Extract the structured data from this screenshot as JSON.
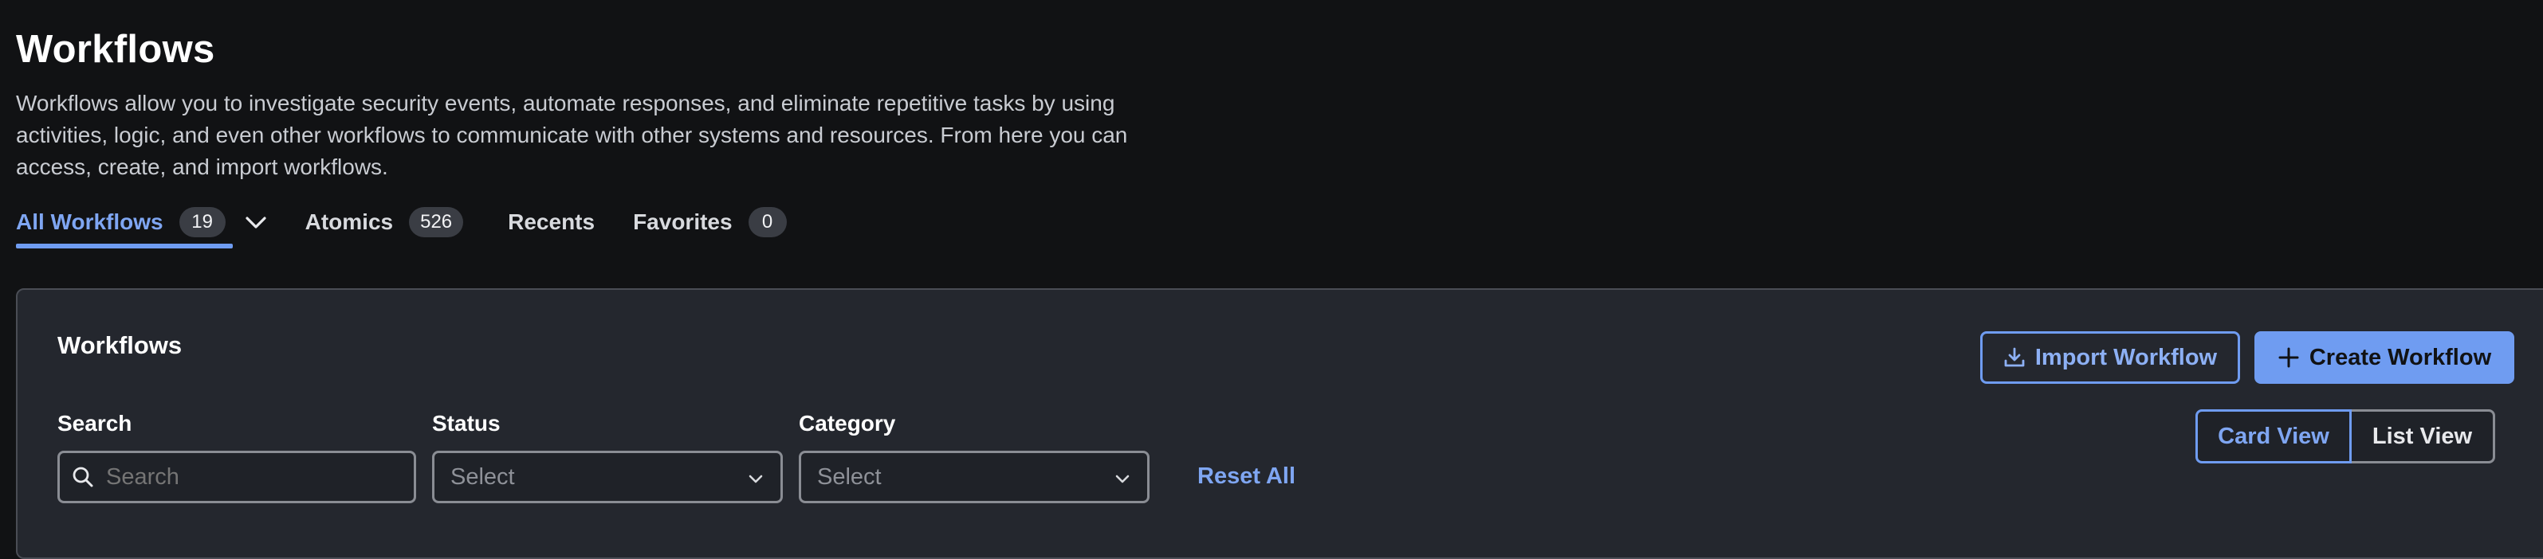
{
  "page": {
    "title": "Workflows",
    "description": "Workflows allow you to investigate security events, automate responses, and eliminate repetitive tasks by using activities, logic, and even other workflows to communicate with other systems and resources. From here you can access, create, and import workflows."
  },
  "tabs": [
    {
      "label": "All Workflows",
      "count": "19",
      "active": true,
      "has_dropdown": true
    },
    {
      "label": "Atomics",
      "count": "526"
    },
    {
      "label": "Recents"
    },
    {
      "label": "Favorites",
      "count": "0"
    }
  ],
  "panel": {
    "title": "Workflows",
    "import_label": "Import Workflow",
    "create_label": "Create Workflow",
    "filters": {
      "search": {
        "label": "Search",
        "placeholder": "Search"
      },
      "status": {
        "label": "Status",
        "value": "Select"
      },
      "category": {
        "label": "Category",
        "value": "Select"
      }
    },
    "reset_label": "Reset All",
    "view": {
      "card_label": "Card View",
      "list_label": "List View",
      "selected": "Card View"
    }
  },
  "colors": {
    "accent": "#6f9cf1",
    "background": "#111214",
    "panel": "#24272e"
  },
  "icons": [
    "chevron-down-icon",
    "download-icon",
    "plus-icon",
    "search-icon"
  ]
}
